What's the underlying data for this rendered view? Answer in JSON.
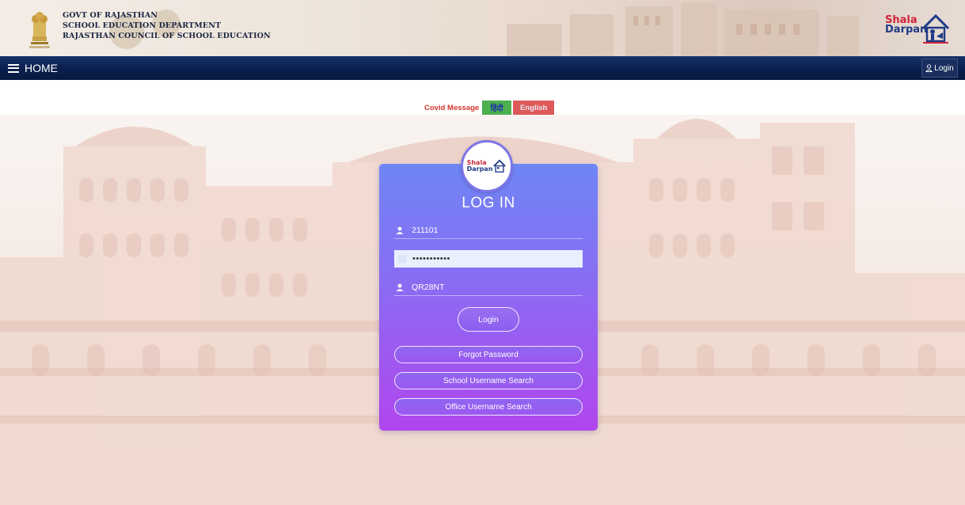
{
  "header": {
    "org_lines": [
      "GOVT OF RAJASTHAN",
      "SCHOOL EDUCATION DEPARTMENT",
      "RAJASTHAN COUNCIL OF SCHOOL EDUCATION"
    ],
    "brand": {
      "line1": "Shala",
      "line2": "Darpan"
    }
  },
  "navbar": {
    "home_label": "HOME",
    "login_label": "Login"
  },
  "covid": {
    "label": "Covid Message",
    "hindi_button": "हिंदी",
    "english_button": "English"
  },
  "login_card": {
    "logo": {
      "line1": "Shala",
      "line2": "Darpan"
    },
    "title": "LOG IN",
    "username_value": "211101",
    "password_value": "•••••••••••",
    "captcha_value": "QR28NT",
    "login_button": "Login",
    "links": [
      "Forgot Password",
      "School Username Search",
      "Office Username Search"
    ]
  },
  "colors": {
    "navbar": "#0b1f4d",
    "card_top": "#6e86f5",
    "card_bottom": "#b046ee",
    "hindi_btn": "#4caf50",
    "english_btn": "#de5959"
  }
}
